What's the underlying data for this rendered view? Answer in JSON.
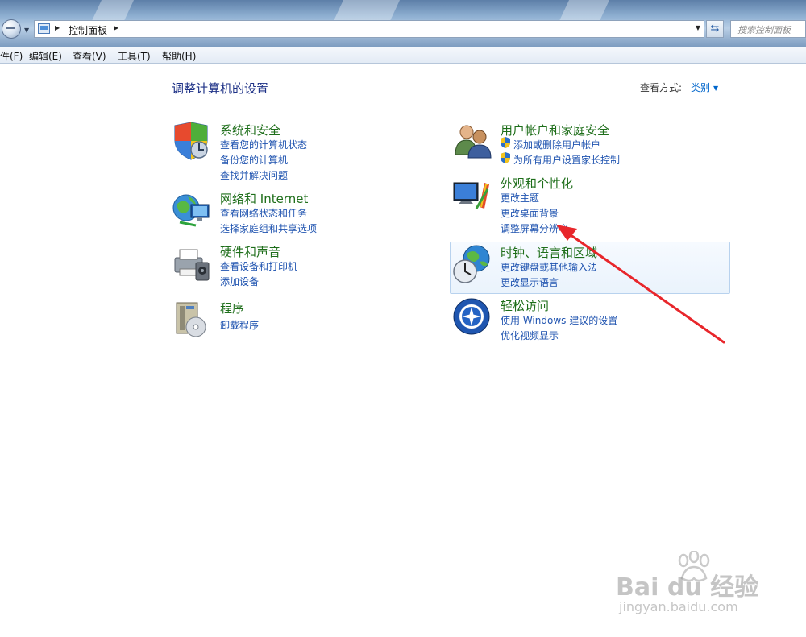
{
  "address": {
    "path": "控制面板",
    "search_placeholder": "搜索控制面板"
  },
  "menu": {
    "items": [
      "件(F)",
      "编辑(E)",
      "查看(V)",
      "工具(T)",
      "帮助(H)"
    ]
  },
  "content": {
    "title": "调整计算机的设置",
    "viewby_label": "查看方式:",
    "viewby_value": "类别"
  },
  "categories": [
    {
      "title": "系统和安全",
      "icon": "shield-icon",
      "links": [
        "查看您的计算机状态",
        "备份您的计算机",
        "查找并解决问题"
      ]
    },
    {
      "title": "网络和 Internet",
      "icon": "network-icon",
      "links": [
        "查看网络状态和任务",
        "选择家庭组和共享选项"
      ]
    },
    {
      "title": "硬件和声音",
      "icon": "printer-icon",
      "links": [
        "查看设备和打印机",
        "添加设备"
      ]
    },
    {
      "title": "程序",
      "icon": "programs-icon",
      "links": [
        "卸载程序"
      ]
    },
    {
      "title": "用户帐户和家庭安全",
      "icon": "users-icon",
      "links": [
        "添加或删除用户帐户",
        "为所有用户设置家长控制"
      ]
    },
    {
      "title": "外观和个性化",
      "icon": "monitor-icon",
      "links": [
        "更改主题",
        "更改桌面背景",
        "调整屏幕分辨率"
      ]
    },
    {
      "title": "时钟、语言和区域",
      "icon": "clock-globe-icon",
      "links": [
        "更改键盘或其他输入法",
        "更改显示语言"
      ]
    },
    {
      "title": "轻松访问",
      "icon": "ease-of-access-icon",
      "links": [
        "使用 Windows 建议的设置",
        "优化视频显示"
      ]
    }
  ],
  "watermark": {
    "brand": "Bai du 经验",
    "url": "jingyan.baidu.com"
  },
  "colors": {
    "category_title": "#1e6e1a",
    "link": "#2054b0",
    "page_title": "#1e3287",
    "annotation_arrow": "#e8262b"
  }
}
